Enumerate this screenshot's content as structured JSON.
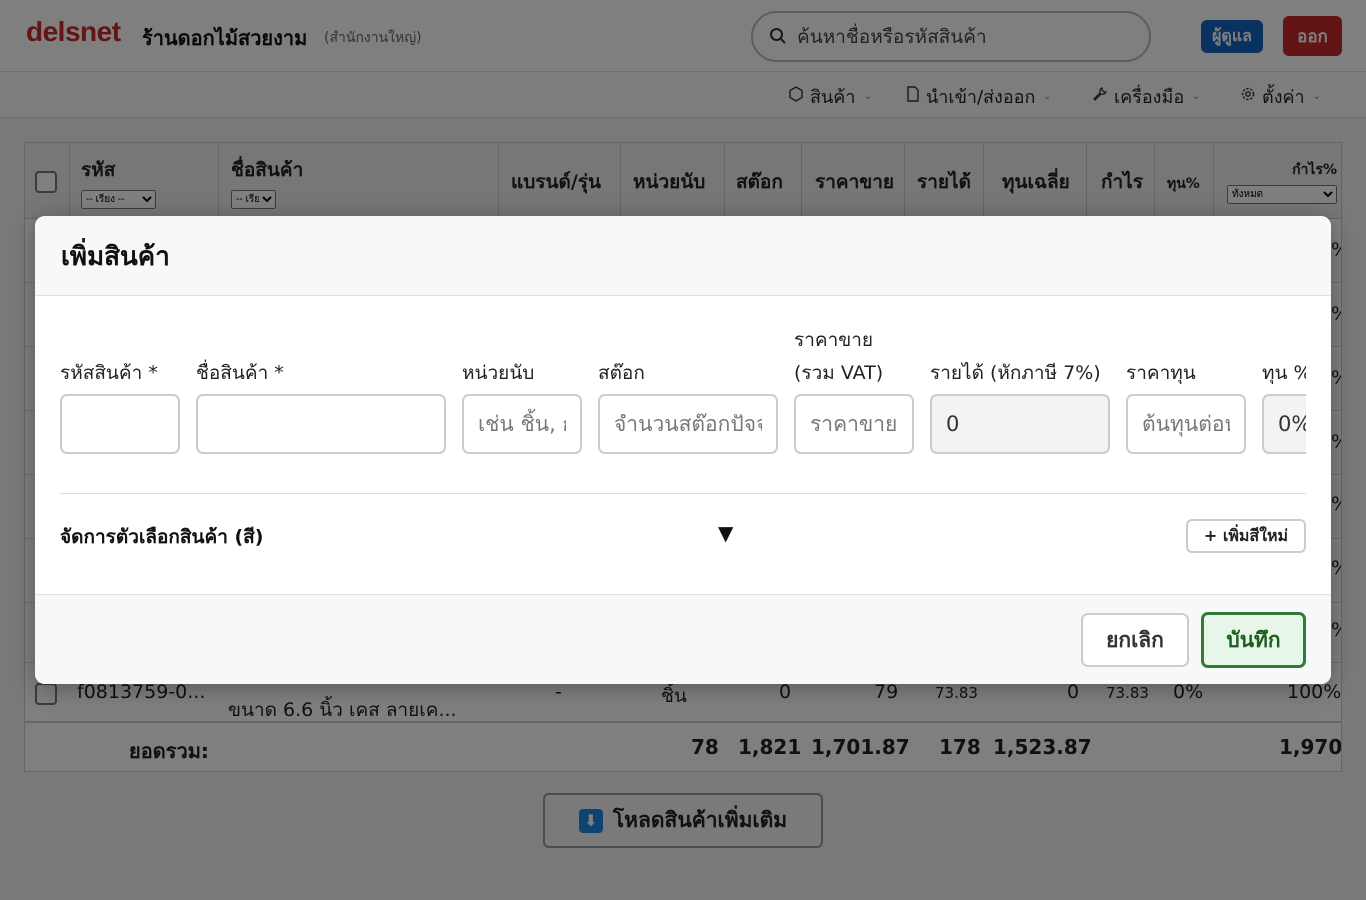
{
  "header": {
    "logo": "delsnet",
    "shop_name": "ร้านดอกไม้สวยงาม",
    "shop_branch": "(สำนักงานใหญ่)",
    "search_placeholder": "ค้นหาชื่อหรือรหัสสินค้า",
    "admin_label": "ผู้ดูแล",
    "logout_label": "ออก"
  },
  "nav": {
    "items": [
      {
        "label": "สินค้า",
        "icon": "box-icon"
      },
      {
        "label": "นำเข้า/ส่งออก",
        "icon": "file-icon"
      },
      {
        "label": "เครื่องมือ",
        "icon": "wrench-icon"
      },
      {
        "label": "ตั้งค่า",
        "icon": "gear-icon"
      }
    ]
  },
  "table": {
    "headers": {
      "code": "รหัส",
      "code_sort": "-- เรียง --",
      "name": "ชื่อสินค้า",
      "name_sort": "-- เรียง --",
      "brand": "แบรนด์/รุ่น",
      "unit": "หน่วยนับ",
      "stock": "สต๊อก",
      "price": "ราคาขาย",
      "revenue": "รายได้",
      "avg_cost": "ทุนเฉลี่ย",
      "profit": "กำไร",
      "cost_pct": "ทุน%",
      "profit_pct": "กำไร%",
      "profit_filter": "ทั้งหมด"
    },
    "last_row": {
      "code": "f0813759-0...",
      "name": "ขนาด 6.6 นิ้ว เคส ลายเค...",
      "brand": "-",
      "unit": "ชิ้น",
      "stock": "0",
      "price": "79",
      "revenue": "73.83",
      "avg_cost": "0",
      "profit": "73.83",
      "cost_pct": "0%",
      "profit_pct": "100%"
    },
    "footer": {
      "label": "ยอดรวม:",
      "unit": "78",
      "stock": "1,821",
      "price": "1,701.87",
      "revenue": "178",
      "avg_cost": "1,523.87",
      "profit_pct": "1,970"
    },
    "edge_pct": "%",
    "load_more": "โหลดสินค้าเพิ่มเติม"
  },
  "modal": {
    "title": "เพิ่มสินค้า",
    "fields": [
      {
        "label": "รหัสสินค้า *",
        "placeholder": "",
        "value": ""
      },
      {
        "label": "ชื่อสินค้า *",
        "placeholder": "",
        "value": ""
      },
      {
        "label": "หน่วยนับ",
        "placeholder": "เช่น ชิ้น, กล่อง",
        "value": ""
      },
      {
        "label": "สต๊อก",
        "placeholder": "จำนวนสต๊อกปัจจุบัน",
        "value": ""
      },
      {
        "label": "ราคาขาย (รวม VAT)",
        "label_line1": "ราคาขาย",
        "label_line2": "(รวม VAT)",
        "placeholder": "ราคาขายรวม VAT",
        "value": ""
      },
      {
        "label": "รายได้ (หักภาษี 7%)",
        "placeholder": "",
        "value": "0"
      },
      {
        "label": "ราคาทุน",
        "placeholder": "ต้นทุนต่อหน่วย",
        "value": ""
      },
      {
        "label": "ทุน %",
        "placeholder": "",
        "value": "0%"
      }
    ],
    "options_label": "จัดการตัวเลือกสินค้า (สี)",
    "options_toggle": "▼",
    "add_color_label": "+ เพิ่มสีใหม่",
    "cancel_label": "ยกเลิก",
    "save_label": "บันทึก"
  },
  "colors": {
    "brand": "#c62828",
    "admin": "#1565c0",
    "save_border": "#2e7d32"
  }
}
